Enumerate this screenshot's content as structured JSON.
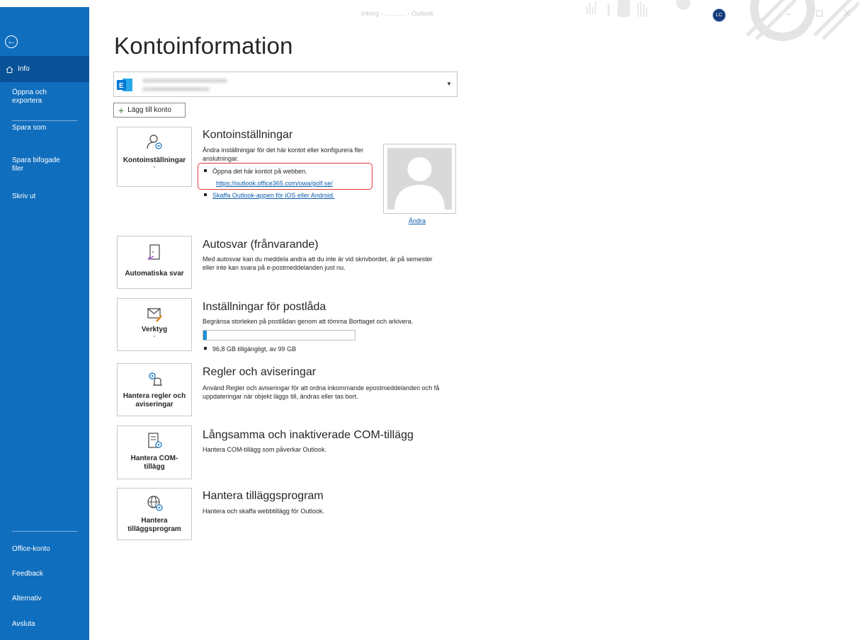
{
  "window": {
    "title": "Inkorg - ............ - Outlook",
    "user_initials": "LC"
  },
  "sidebar": {
    "info": "Info",
    "items": [
      {
        "label": "Öppna och exportera"
      },
      {
        "label": "Spara som"
      },
      {
        "label": "Spara bifogade filer"
      },
      {
        "label": "Skriv ut"
      }
    ],
    "bottom": [
      {
        "label": "Office-konto"
      },
      {
        "label": "Feedback"
      },
      {
        "label": "Alternativ"
      },
      {
        "label": "Avsluta"
      }
    ]
  },
  "page": {
    "title": "Kontoinformation",
    "add_account": "Lägg till konto"
  },
  "account_settings": {
    "tile_label": "Kontoinställningar",
    "title": "Kontoinställningar",
    "desc": "Ändra inställningar för det här kontot eller konfigurera fler anslutningar.",
    "bullet_1": "Öppna det här kontot på webben.",
    "link_web": "https://outlook.office365.com/owa/golf.se/",
    "link_app": "Skaffa Outlook-appen för iOS eller Android.",
    "change_photo": "Ändra"
  },
  "auto_reply": {
    "tile_label": "Automatiska svar",
    "title": "Autosvar (frånvarande)",
    "desc": "Med autosvar kan du meddela andra att du inte är vid skrivbordet, är på semester eller inte kan svara på e-postmeddelanden just nu."
  },
  "mailbox": {
    "tile_label": "Verktyg",
    "title": "Inställningar för postlåda",
    "desc": "Begränsa storleken på postlådan genom att tömma Borttaget och arkivera.",
    "usage_fraction": 0.022,
    "storage": "96,8 GB tillgängligt, av 99 GB"
  },
  "rules": {
    "tile_label": "Hantera regler och aviseringar",
    "title": "Regler och aviseringar",
    "desc": "Använd Regler och aviseringar för att ordna inkommande epostmeddelanden och få uppdateringar när objekt läggs till, ändras eller tas bort."
  },
  "com": {
    "tile_label": "Hantera COM-tillägg",
    "title": "Långsamma och inaktiverade COM-tillägg",
    "desc": "Hantera COM-tillägg som påverkar Outlook."
  },
  "addins": {
    "tile_label": "Hantera tilläggsprogram",
    "title": "Hantera tilläggsprogram",
    "desc": "Hantera och skaffa webbtillägg för Outlook."
  }
}
